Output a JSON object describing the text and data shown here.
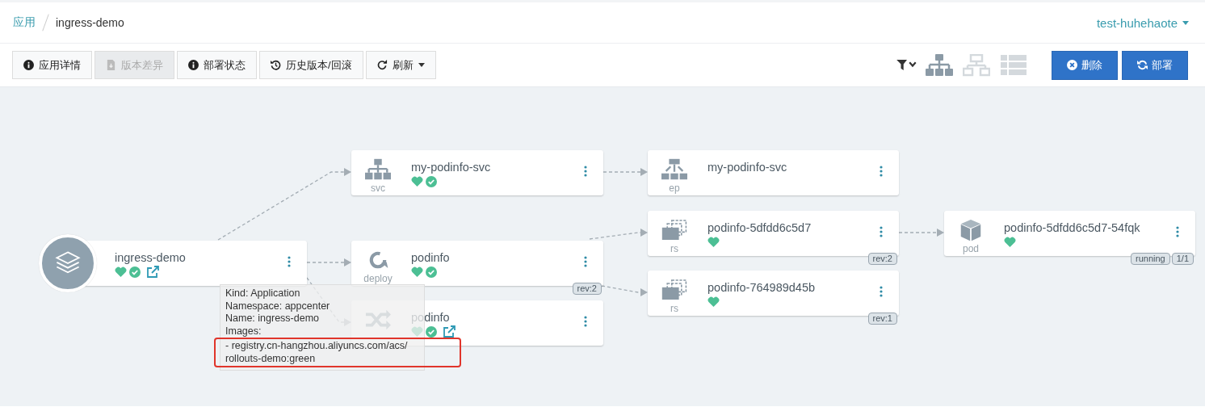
{
  "breadcrumb": [
    {
      "label": "应用",
      "kind": "link"
    },
    {
      "label": "ingress-demo",
      "kind": "current"
    }
  ],
  "cluster": {
    "label": "test-huhehaote"
  },
  "toolbar": {
    "actions": [
      {
        "label": "应用详情",
        "kind": "info",
        "disabled": false,
        "dropdown": false
      },
      {
        "label": "版本差异",
        "kind": "diff",
        "disabled": true,
        "dropdown": false
      },
      {
        "label": "部署状态",
        "kind": "info",
        "disabled": false,
        "dropdown": false
      },
      {
        "label": "历史版本/回滚",
        "kind": "history",
        "disabled": false,
        "dropdown": false
      },
      {
        "label": "刷新",
        "kind": "refresh",
        "disabled": false,
        "dropdown": true
      }
    ],
    "views": [
      {
        "kind": "tree",
        "selected": true
      },
      {
        "kind": "network",
        "selected": false
      },
      {
        "kind": "list",
        "selected": false
      }
    ],
    "primary_actions": [
      {
        "label": "删除",
        "kind": "delete"
      },
      {
        "label": "部署",
        "kind": "deploy"
      }
    ]
  },
  "nodes": [
    {
      "kind": "app",
      "name": "ingress-demo",
      "statuses": [
        {
          "kind": "healthy"
        },
        {
          "kind": "synced"
        },
        {
          "kind": "link"
        }
      ]
    },
    {
      "kind": "svc",
      "name": "my-podinfo-svc",
      "type_label": "svc",
      "statuses": [
        {
          "kind": "healthy"
        },
        {
          "kind": "synced"
        }
      ]
    },
    {
      "kind": "ep",
      "name": "my-podinfo-svc",
      "type_label": "ep"
    },
    {
      "kind": "deploy",
      "name": "podinfo",
      "type_label": "deploy",
      "statuses": [
        {
          "kind": "healthy"
        },
        {
          "kind": "synced"
        }
      ],
      "badges": [
        "rev:2"
      ]
    },
    {
      "kind": "rollout",
      "name": "podinfo",
      "statuses": [
        {
          "kind": "healthy"
        },
        {
          "kind": "synced"
        },
        {
          "kind": "link"
        }
      ]
    },
    {
      "kind": "rs",
      "name": "podinfo-5dfdd6c5d7",
      "type_label": "rs",
      "statuses": [
        {
          "kind": "healthy"
        }
      ],
      "badges": [
        "rev:2"
      ]
    },
    {
      "kind": "rs",
      "name": "podinfo-764989d45b",
      "type_label": "rs",
      "statuses": [
        {
          "kind": "healthy"
        }
      ],
      "badges": [
        "rev:1"
      ]
    },
    {
      "kind": "pod",
      "name": "podinfo-5dfdd6c5d7-54fqk",
      "type_label": "pod",
      "statuses": [
        {
          "kind": "healthy"
        }
      ],
      "badges": [
        "running",
        "1/1"
      ]
    }
  ],
  "tooltip": {
    "lines": [
      {
        "text": "Kind: Application",
        "highlighted": false
      },
      {
        "text": "Namespace: appcenter",
        "highlighted": false
      },
      {
        "text": "Name: ingress-demo",
        "highlighted": false
      },
      {
        "text": "Images:",
        "highlighted": false
      },
      {
        "text": "- registry.cn-hangzhou.aliyuncs.com/acs/",
        "highlighted": true
      },
      {
        "text": "rollouts-demo:green",
        "highlighted": true
      }
    ]
  }
}
